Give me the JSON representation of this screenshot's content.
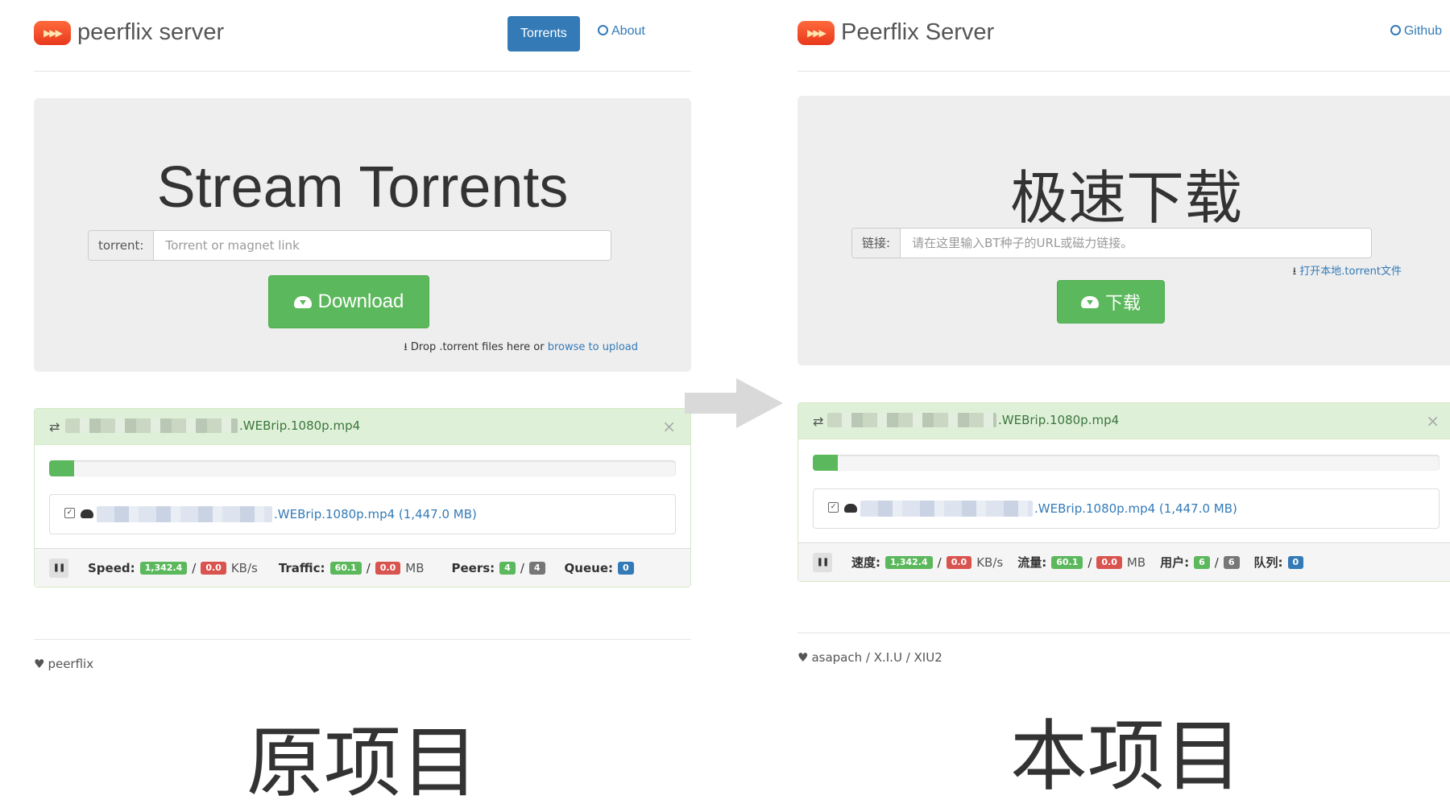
{
  "left": {
    "brand": "peerflix server",
    "nav_torrents": "Torrents",
    "nav_about": "About",
    "hero_title": "Stream Torrents",
    "input_label": "torrent:",
    "input_placeholder": "Torrent or magnet link",
    "download_label": "Download",
    "drop_hint": "Drop .torrent files here or",
    "browse_link": "browse to upload",
    "torrent_name": ".WEBrip.1080p.mp4",
    "file_name": ".WEBrip.1080p.mp4 (1,447.0 MB)",
    "progress": 0.04,
    "stats": {
      "speed_label": "Speed:",
      "speed_down": "1,342.4",
      "speed_up": "0.0",
      "speed_unit": "KB/s",
      "traffic_label": "Traffic:",
      "traffic_down": "60.1",
      "traffic_up": "0.0",
      "traffic_unit": "MB",
      "peers_label": "Peers:",
      "peers_active": "4",
      "peers_total": "4",
      "queue_label": "Queue:",
      "queue": "0"
    },
    "footer": "peerflix",
    "caption": "原项目"
  },
  "right": {
    "brand": "Peerflix Server",
    "nav_github": "Github",
    "hero_title": "极速下载",
    "input_label": "链接:",
    "input_placeholder": "请在这里输入BT种子的URL或磁力链接。",
    "open_local": "打开本地.torrent文件",
    "download_label": "下载",
    "torrent_name": ".WEBrip.1080p.mp4",
    "file_name": ".WEBrip.1080p.mp4 (1,447.0 MB)",
    "progress": 0.04,
    "stats": {
      "speed_label": "速度:",
      "speed_down": "1,342.4",
      "speed_up": "0.0",
      "speed_unit": "KB/s",
      "traffic_label": "流量:",
      "traffic_down": "60.1",
      "traffic_up": "0.0",
      "traffic_unit": "MB",
      "peers_label": "用户:",
      "peers_active": "6",
      "peers_total": "6",
      "queue_label": "队列:",
      "queue": "0"
    },
    "footer": "asapach / X.I.U / XIU2",
    "caption": "本项目"
  },
  "colors": {
    "primary": "#337ab7",
    "success": "#5cb85c",
    "danger": "#d9534f",
    "muted": "#777777"
  }
}
